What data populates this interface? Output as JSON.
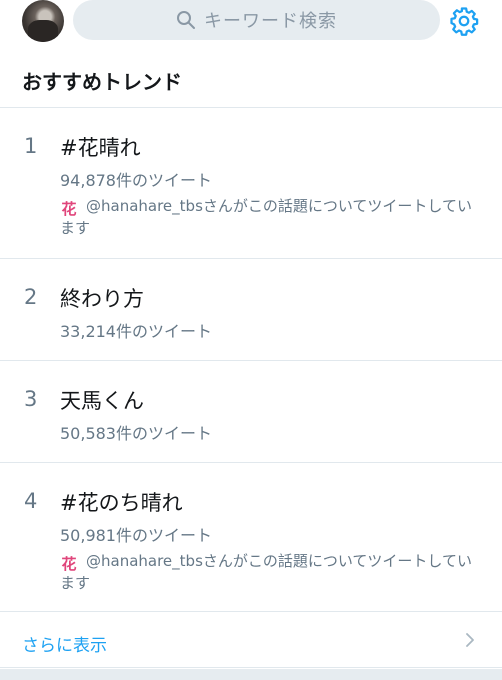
{
  "search": {
    "placeholder": "キーワード検索",
    "icon": "search-icon"
  },
  "settings": {
    "icon": "gear-icon",
    "color": "#1da1f2"
  },
  "header": {
    "title": "おすすめトレンド"
  },
  "trends": [
    {
      "rank": "1",
      "name": "#花晴れ",
      "count": "94,878件のツイート",
      "context_icon": "花",
      "context": "@hanahare_tbsさんがこの話題についてツイートしています"
    },
    {
      "rank": "2",
      "name": "終わり方",
      "count": "33,214件のツイート"
    },
    {
      "rank": "3",
      "name": "天馬くん",
      "count": "50,583件のツイート"
    },
    {
      "rank": "4",
      "name": "#花のち晴れ",
      "count": "50,981件のツイート",
      "context_icon": "花",
      "context": "@hanahare_tbsさんがこの話題についてツイートしています"
    }
  ],
  "footer": {
    "more_label": "さらに表示"
  },
  "colors": {
    "accent": "#1da1f2",
    "secondary_text": "#657786",
    "divider": "#e1e8ed"
  }
}
